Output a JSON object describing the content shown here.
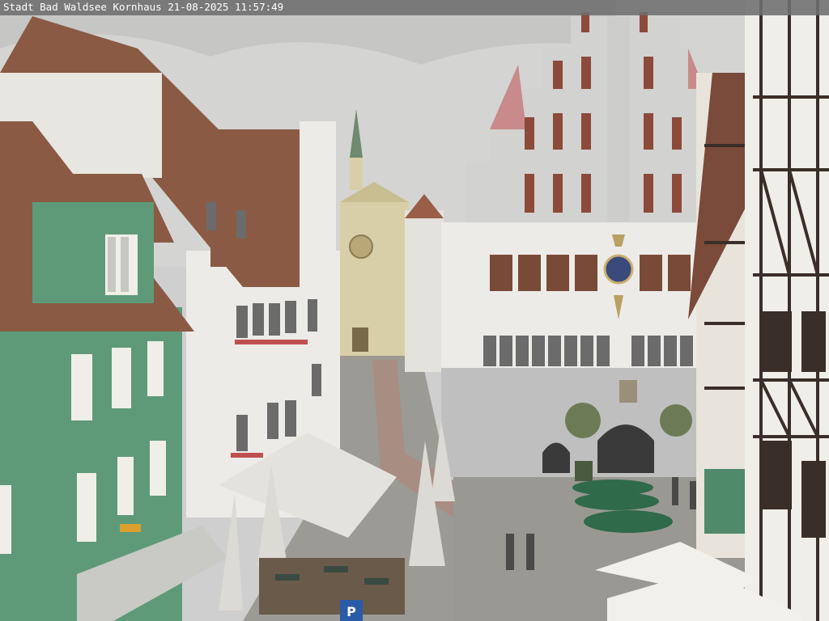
{
  "webcam": {
    "caption": "Stadt Bad Waldsee Kornhaus 21-08-2025 11:57:49"
  },
  "scene": {
    "subject": "town-square-webcam-view",
    "colors": {
      "sky": "#d4d4d2",
      "green_house": "#5f9a78",
      "roof": "#8b5a44",
      "stone": "#bcbcbc",
      "white_wall": "#ecebe8",
      "timber": "#3a2e28",
      "umbrella_green": "#2f6a4a",
      "pavement": "#9c9a94"
    },
    "signs": {
      "parking_letter": "P"
    }
  }
}
